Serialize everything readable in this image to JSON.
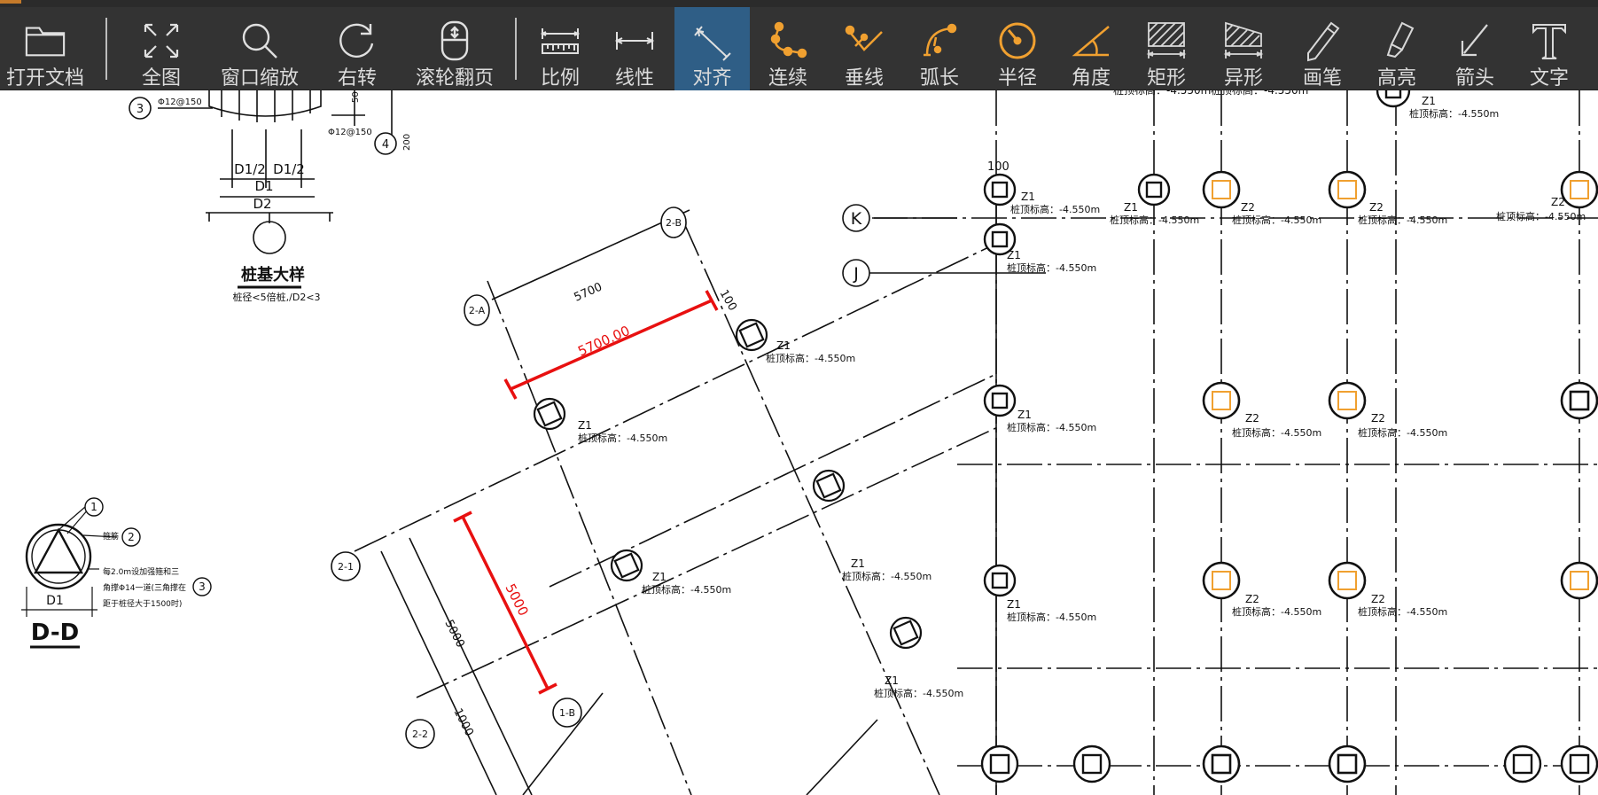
{
  "toolbar": {
    "tools": [
      {
        "id": "open",
        "label": "打开文档",
        "icon": "folder-icon"
      },
      {
        "id": "fit",
        "label": "全图",
        "icon": "fit-all-icon"
      },
      {
        "id": "zoom-window",
        "label": "窗口缩放",
        "icon": "magnifier-icon"
      },
      {
        "id": "rotate",
        "label": "右转",
        "icon": "rotate-right-icon"
      },
      {
        "id": "wheel-page",
        "label": "滚轮翻页",
        "icon": "mouse-wheel-icon"
      },
      {
        "id": "scale",
        "label": "比例",
        "icon": "scale-ruler-icon"
      },
      {
        "id": "linear",
        "label": "线性",
        "icon": "linear-measure-icon"
      },
      {
        "id": "align",
        "label": "对齐",
        "icon": "aligned-measure-icon",
        "active": true
      },
      {
        "id": "continuous",
        "label": "连续",
        "icon": "continuous-measure-icon"
      },
      {
        "id": "perpendicular",
        "label": "垂线",
        "icon": "perpendicular-icon"
      },
      {
        "id": "arc-length",
        "label": "弧长",
        "icon": "arc-length-icon"
      },
      {
        "id": "radius",
        "label": "半径",
        "icon": "radius-icon"
      },
      {
        "id": "angle",
        "label": "角度",
        "icon": "angle-icon"
      },
      {
        "id": "rect-area",
        "label": "矩形",
        "icon": "rect-area-icon"
      },
      {
        "id": "irregular-area",
        "label": "异形",
        "icon": "irregular-area-icon"
      },
      {
        "id": "pen",
        "label": "画笔",
        "icon": "pen-icon"
      },
      {
        "id": "highlight",
        "label": "高亮",
        "icon": "highlighter-icon"
      },
      {
        "id": "arrow",
        "label": "箭头",
        "icon": "arrow-icon"
      },
      {
        "id": "text",
        "label": "文字",
        "icon": "text-icon"
      }
    ],
    "accent_color": "#f0a030",
    "active_bg": "#2f5e86"
  },
  "drawing": {
    "axes": {
      "k": "K",
      "j": "J",
      "a2": "2-A",
      "b2": "2-B",
      "n21": "2-1",
      "n22": "2-2",
      "b1": "1-B"
    },
    "dimensions": {
      "d5700": "5700",
      "d5700_measured": "5700.00",
      "d5000_measured": "5000",
      "d5000": "5000",
      "d1000": "1000",
      "d100": "100",
      "d100b": "100",
      "d50": "50",
      "d200": "200"
    },
    "column_labels": {
      "z1": "Z1",
      "z2": "Z2",
      "elev": "桩顶标高：-4.550m",
      "elev_short": "-4.550m"
    },
    "detail": {
      "pile_title": "桩基大样",
      "pile_note": "桩径<5倍桩,/D2<3",
      "d1_half": "D1/2",
      "d1_half_b": "D1/2",
      "d1": "D1",
      "d2": "D2",
      "rebar_a": "Φ12@150",
      "rebar_b": "Φ12@150",
      "n1": "1",
      "n2": "2",
      "n3": "3",
      "n3b": "3",
      "n4": "4",
      "dd_title": "D-D",
      "dd_d1": "D1",
      "note_stirrup": "箍筋",
      "note_line1": "每2.0m设加强箍和三",
      "note_line2": "角撑Φ14一道(三角撑在",
      "note_line3": "距于桩径大于1500时)"
    },
    "measure_color": "#e81010"
  }
}
